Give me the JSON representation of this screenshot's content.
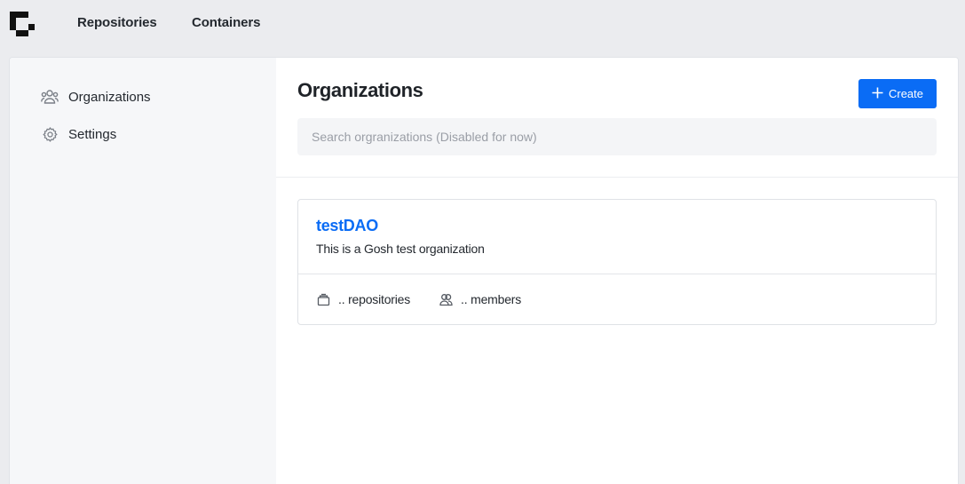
{
  "nav": {
    "links": [
      "Repositories",
      "Containers"
    ]
  },
  "sidebar": {
    "items": [
      {
        "label": "Organizations",
        "icon": "users-icon"
      },
      {
        "label": "Settings",
        "icon": "gear-icon"
      }
    ]
  },
  "main": {
    "title": "Organizations",
    "create_label": "Create",
    "search_placeholder": "Search orgranizations (Disabled for now)",
    "organizations": [
      {
        "name": "testDAO",
        "description": "This is a Gosh test organization",
        "repositories": ".. repositories",
        "members": ".. members"
      }
    ]
  },
  "colors": {
    "accent": "#0a6cf5",
    "background": "#ebecef",
    "sidebar": "#f6f7f9"
  }
}
